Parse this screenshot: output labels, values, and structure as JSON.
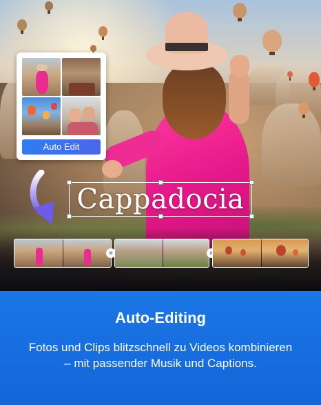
{
  "collage": {
    "button_label": "Auto Edit"
  },
  "overlay_title": {
    "text": "Cappadocia"
  },
  "timeline": {
    "transition_glyph": "»"
  },
  "feature": {
    "title": "Auto-Editing",
    "description": "Fotos und Clips blitzschnell zu Videos kombinieren – mit passender Musik und Captions."
  },
  "colors": {
    "panel_blue": "#1b76e6",
    "button_blue": "#2f7df0",
    "dress_pink": "#e6198a",
    "arrow_purple": "#6c5ce7"
  }
}
